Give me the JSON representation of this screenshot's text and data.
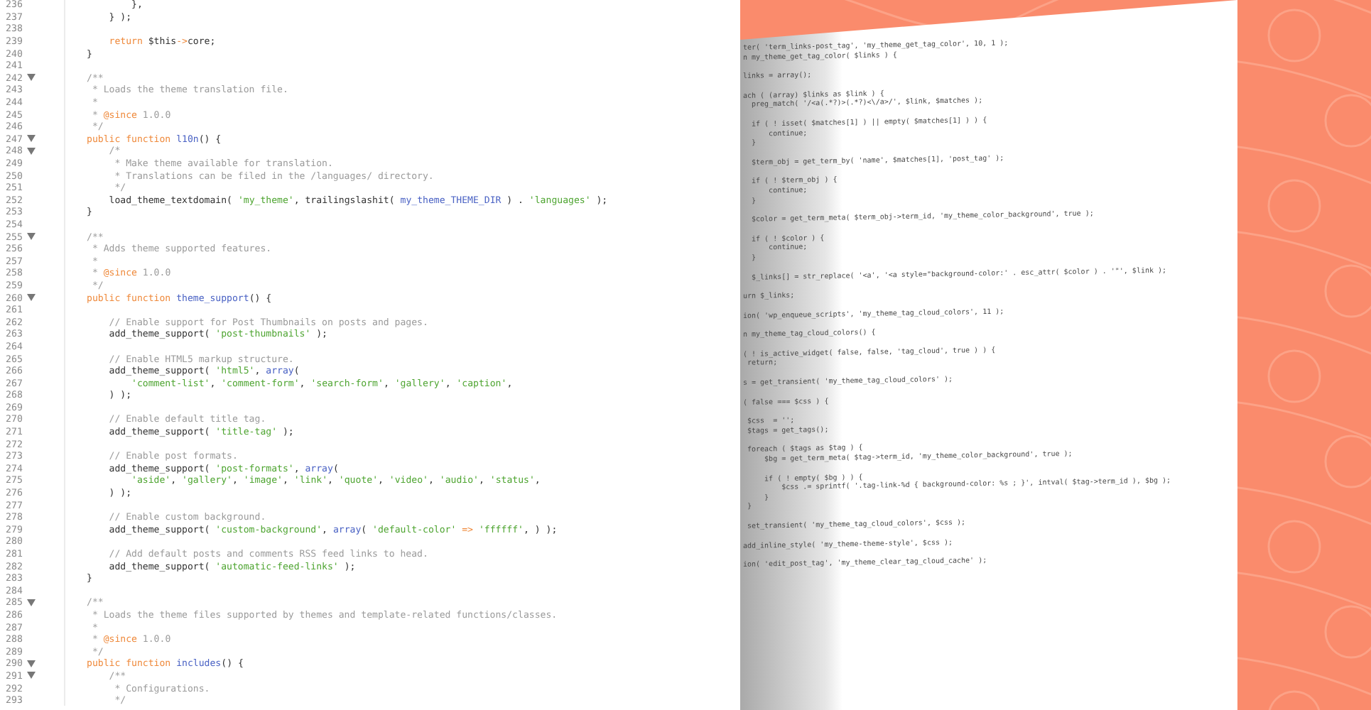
{
  "editor": {
    "lines": [
      {
        "number": "236",
        "fold": false,
        "tokens": [
          {
            "kind": "plain",
            "text": "        },"
          }
        ]
      },
      {
        "number": "237",
        "fold": false,
        "tokens": [
          {
            "kind": "plain",
            "text": "    } );"
          }
        ]
      },
      {
        "number": "238",
        "fold": false
      },
      {
        "number": "239",
        "fold": false,
        "tokens": [
          {
            "kind": "keyword",
            "text": "    return"
          },
          {
            "kind": "plain",
            "text": " $this"
          },
          {
            "kind": "keyword",
            "text": "->"
          },
          {
            "kind": "plain",
            "text": "core;"
          }
        ]
      },
      {
        "number": "240",
        "fold": false,
        "tokens": [
          {
            "kind": "plain",
            "text": "}"
          }
        ]
      },
      {
        "number": "241",
        "fold": false
      },
      {
        "number": "242",
        "fold": true,
        "tokens": [
          {
            "kind": "comment",
            "text": "/**"
          }
        ]
      },
      {
        "number": "243",
        "fold": false,
        "tokens": [
          {
            "kind": "comment",
            "text": " * Loads the theme translation file."
          }
        ]
      },
      {
        "number": "244",
        "fold": false,
        "tokens": [
          {
            "kind": "comment",
            "text": " *"
          }
        ]
      },
      {
        "number": "245",
        "fold": false,
        "tokens": [
          {
            "kind": "comment",
            "text": " * "
          },
          {
            "kind": "keyword",
            "text": "@since"
          },
          {
            "kind": "comment",
            "text": " 1.0.0"
          }
        ]
      },
      {
        "number": "246",
        "fold": false,
        "tokens": [
          {
            "kind": "comment",
            "text": " */"
          }
        ]
      },
      {
        "number": "247",
        "fold": true,
        "tokens": [
          {
            "kind": "keyword",
            "text": "public function "
          },
          {
            "kind": "function",
            "text": "l10n"
          },
          {
            "kind": "plain",
            "text": "() {"
          }
        ]
      },
      {
        "number": "248",
        "fold": true,
        "tokens": [
          {
            "kind": "comment",
            "text": "    /*"
          }
        ]
      },
      {
        "number": "249",
        "fold": false,
        "tokens": [
          {
            "kind": "comment",
            "text": "     * Make theme available for translation."
          }
        ]
      },
      {
        "number": "250",
        "fold": false,
        "tokens": [
          {
            "kind": "comment",
            "text": "     * Translations can be filed in the /languages/ directory."
          }
        ]
      },
      {
        "number": "251",
        "fold": false,
        "tokens": [
          {
            "kind": "comment",
            "text": "     */"
          }
        ]
      },
      {
        "number": "252",
        "fold": false,
        "tokens": [
          {
            "kind": "plain",
            "text": "    load_theme_textdomain( "
          },
          {
            "kind": "string",
            "text": "'my_theme'"
          },
          {
            "kind": "plain",
            "text": ", trailingslashit( "
          },
          {
            "kind": "function",
            "text": "my_theme_THEME_DIR"
          },
          {
            "kind": "plain",
            "text": " ) . "
          },
          {
            "kind": "string",
            "text": "'languages'"
          },
          {
            "kind": "plain",
            "text": " );"
          }
        ]
      },
      {
        "number": "253",
        "fold": false,
        "tokens": [
          {
            "kind": "plain",
            "text": "}"
          }
        ]
      },
      {
        "number": "254",
        "fold": false
      },
      {
        "number": "255",
        "fold": true,
        "tokens": [
          {
            "kind": "comment",
            "text": "/**"
          }
        ]
      },
      {
        "number": "256",
        "fold": false,
        "tokens": [
          {
            "kind": "comment",
            "text": " * Adds theme supported features."
          }
        ]
      },
      {
        "number": "257",
        "fold": false,
        "tokens": [
          {
            "kind": "comment",
            "text": " *"
          }
        ]
      },
      {
        "number": "258",
        "fold": false,
        "tokens": [
          {
            "kind": "comment",
            "text": " * "
          },
          {
            "kind": "keyword",
            "text": "@since"
          },
          {
            "kind": "comment",
            "text": " 1.0.0"
          }
        ]
      },
      {
        "number": "259",
        "fold": false,
        "tokens": [
          {
            "kind": "comment",
            "text": " */"
          }
        ]
      },
      {
        "number": "260",
        "fold": true,
        "tokens": [
          {
            "kind": "keyword",
            "text": "public function "
          },
          {
            "kind": "function",
            "text": "theme_support"
          },
          {
            "kind": "plain",
            "text": "() {"
          }
        ]
      },
      {
        "number": "261",
        "fold": false
      },
      {
        "number": "262",
        "fold": false,
        "tokens": [
          {
            "kind": "comment",
            "text": "    // Enable support for Post Thumbnails on posts and pages."
          }
        ]
      },
      {
        "number": "263",
        "fold": false,
        "tokens": [
          {
            "kind": "plain",
            "text": "    add_theme_support( "
          },
          {
            "kind": "string",
            "text": "'post-thumbnails'"
          },
          {
            "kind": "plain",
            "text": " );"
          }
        ]
      },
      {
        "number": "264",
        "fold": false
      },
      {
        "number": "265",
        "fold": false,
        "tokens": [
          {
            "kind": "comment",
            "text": "    // Enable HTML5 markup structure."
          }
        ]
      },
      {
        "number": "266",
        "fold": false,
        "tokens": [
          {
            "kind": "plain",
            "text": "    add_theme_support( "
          },
          {
            "kind": "string",
            "text": "'html5'"
          },
          {
            "kind": "plain",
            "text": ", "
          },
          {
            "kind": "function",
            "text": "array"
          },
          {
            "kind": "plain",
            "text": "("
          }
        ]
      },
      {
        "number": "267",
        "fold": false,
        "tokens": [
          {
            "kind": "string",
            "text": "        'comment-list'"
          },
          {
            "kind": "plain",
            "text": ", "
          },
          {
            "kind": "string",
            "text": "'comment-form'"
          },
          {
            "kind": "plain",
            "text": ", "
          },
          {
            "kind": "string",
            "text": "'search-form'"
          },
          {
            "kind": "plain",
            "text": ", "
          },
          {
            "kind": "string",
            "text": "'gallery'"
          },
          {
            "kind": "plain",
            "text": ", "
          },
          {
            "kind": "string",
            "text": "'caption'"
          },
          {
            "kind": "plain",
            "text": ","
          }
        ]
      },
      {
        "number": "268",
        "fold": false,
        "tokens": [
          {
            "kind": "plain",
            "text": "    ) );"
          }
        ]
      },
      {
        "number": "269",
        "fold": false
      },
      {
        "number": "270",
        "fold": false,
        "tokens": [
          {
            "kind": "comment",
            "text": "    // Enable default title tag."
          }
        ]
      },
      {
        "number": "271",
        "fold": false,
        "tokens": [
          {
            "kind": "plain",
            "text": "    add_theme_support( "
          },
          {
            "kind": "string",
            "text": "'title-tag'"
          },
          {
            "kind": "plain",
            "text": " );"
          }
        ]
      },
      {
        "number": "272",
        "fold": false
      },
      {
        "number": "273",
        "fold": false,
        "tokens": [
          {
            "kind": "comment",
            "text": "    // Enable post formats."
          }
        ]
      },
      {
        "number": "274",
        "fold": false,
        "tokens": [
          {
            "kind": "plain",
            "text": "    add_theme_support( "
          },
          {
            "kind": "string",
            "text": "'post-formats'"
          },
          {
            "kind": "plain",
            "text": ", "
          },
          {
            "kind": "function",
            "text": "array"
          },
          {
            "kind": "plain",
            "text": "("
          }
        ]
      },
      {
        "number": "275",
        "fold": false,
        "tokens": [
          {
            "kind": "string",
            "text": "        'aside'"
          },
          {
            "kind": "plain",
            "text": ", "
          },
          {
            "kind": "string",
            "text": "'gallery'"
          },
          {
            "kind": "plain",
            "text": ", "
          },
          {
            "kind": "string",
            "text": "'image'"
          },
          {
            "kind": "plain",
            "text": ", "
          },
          {
            "kind": "string",
            "text": "'link'"
          },
          {
            "kind": "plain",
            "text": ", "
          },
          {
            "kind": "string",
            "text": "'quote'"
          },
          {
            "kind": "plain",
            "text": ", "
          },
          {
            "kind": "string",
            "text": "'video'"
          },
          {
            "kind": "plain",
            "text": ", "
          },
          {
            "kind": "string",
            "text": "'audio'"
          },
          {
            "kind": "plain",
            "text": ", "
          },
          {
            "kind": "string",
            "text": "'status'"
          },
          {
            "kind": "plain",
            "text": ","
          }
        ]
      },
      {
        "number": "276",
        "fold": false,
        "tokens": [
          {
            "kind": "plain",
            "text": "    ) );"
          }
        ]
      },
      {
        "number": "277",
        "fold": false
      },
      {
        "number": "278",
        "fold": false,
        "tokens": [
          {
            "kind": "comment",
            "text": "    // Enable custom background."
          }
        ]
      },
      {
        "number": "279",
        "fold": false,
        "tokens": [
          {
            "kind": "plain",
            "text": "    add_theme_support( "
          },
          {
            "kind": "string",
            "text": "'custom-background'"
          },
          {
            "kind": "plain",
            "text": ", "
          },
          {
            "kind": "function",
            "text": "array"
          },
          {
            "kind": "plain",
            "text": "( "
          },
          {
            "kind": "string",
            "text": "'default-color'"
          },
          {
            "kind": "keyword",
            "text": " => "
          },
          {
            "kind": "string",
            "text": "'ffffff'"
          },
          {
            "kind": "plain",
            "text": ", ) );"
          }
        ]
      },
      {
        "number": "280",
        "fold": false
      },
      {
        "number": "281",
        "fold": false,
        "tokens": [
          {
            "kind": "comment",
            "text": "    // Add default posts and comments RSS feed links to head."
          }
        ]
      },
      {
        "number": "282",
        "fold": false,
        "tokens": [
          {
            "kind": "plain",
            "text": "    add_theme_support( "
          },
          {
            "kind": "string",
            "text": "'automatic-feed-links'"
          },
          {
            "kind": "plain",
            "text": " );"
          }
        ]
      },
      {
        "number": "283",
        "fold": false,
        "tokens": [
          {
            "kind": "plain",
            "text": "}"
          }
        ]
      },
      {
        "number": "284",
        "fold": false
      },
      {
        "number": "285",
        "fold": true,
        "tokens": [
          {
            "kind": "comment",
            "text": "/**"
          }
        ]
      },
      {
        "number": "286",
        "fold": false,
        "tokens": [
          {
            "kind": "comment",
            "text": " * Loads the theme files supported by themes and template-related functions/classes."
          }
        ]
      },
      {
        "number": "287",
        "fold": false,
        "tokens": [
          {
            "kind": "comment",
            "text": " *"
          }
        ]
      },
      {
        "number": "288",
        "fold": false,
        "tokens": [
          {
            "kind": "comment",
            "text": " * "
          },
          {
            "kind": "keyword",
            "text": "@since"
          },
          {
            "kind": "comment",
            "text": " 1.0.0"
          }
        ]
      },
      {
        "number": "289",
        "fold": false,
        "tokens": [
          {
            "kind": "comment",
            "text": " */"
          }
        ]
      },
      {
        "number": "290",
        "fold": true,
        "tokens": [
          {
            "kind": "keyword",
            "text": "public function "
          },
          {
            "kind": "function",
            "text": "includes"
          },
          {
            "kind": "plain",
            "text": "() {"
          }
        ]
      },
      {
        "number": "291",
        "fold": true,
        "tokens": [
          {
            "kind": "comment",
            "text": "    /**"
          }
        ]
      },
      {
        "number": "292",
        "fold": false,
        "tokens": [
          {
            "kind": "comment",
            "text": "     * Configurations."
          }
        ]
      },
      {
        "number": "293",
        "fold": false,
        "tokens": [
          {
            "kind": "comment",
            "text": "     */"
          }
        ]
      }
    ]
  },
  "code_sheet": {
    "blocks": [
      [
        "ter( 'term_links-post_tag', 'my_theme_get_tag_color', 10, 1 );",
        "n my_theme_get_tag_color( $links ) {"
      ],
      [
        "links = array();"
      ],
      [
        "ach ( (array) $links as $link ) {",
        "  preg_match( '/<a(.*?)>(.*?)<\\/a>/', $link, $matches );"
      ],
      [
        "  if ( ! isset( $matches[1] ) || empty( $matches[1] ) ) {",
        "      continue;",
        "  }"
      ],
      [
        "  $term_obj = get_term_by( 'name', $matches[1], 'post_tag' );"
      ],
      [
        "  if ( ! $term_obj ) {",
        "      continue;",
        "  }"
      ],
      [
        "  $color = get_term_meta( $term_obj->term_id, 'my_theme_color_background', true );"
      ],
      [
        "  if ( ! $color ) {",
        "      continue;",
        "  }"
      ],
      [
        "  $_links[] = str_replace( '<a', '<a style=\"background-color:' . esc_attr( $color ) . '\"', $link );"
      ],
      [
        "urn $_links;"
      ],
      [
        "ion( 'wp_enqueue_scripts', 'my_theme_tag_cloud_colors', 11 );"
      ],
      [
        "n my_theme_tag_cloud_colors() {"
      ],
      [
        "( ! is_active_widget( false, false, 'tag_cloud', true ) ) {",
        " return;"
      ],
      [
        "s = get_transient( 'my_theme_tag_cloud_colors' );"
      ],
      [
        "( false === $css ) {"
      ],
      [
        " $css  = '';",
        " $tags = get_tags();"
      ],
      [
        " foreach ( $tags as $tag ) {",
        "     $bg = get_term_meta( $tag->term_id, 'my_theme_color_background', true );"
      ],
      [
        "     if ( ! empty( $bg ) ) {",
        "         $css .= sprintf( '.tag-link-%d { background-color: %s ; }', intval( $tag->term_id ), $bg );",
        "     }",
        " }"
      ],
      [
        " set_transient( 'my_theme_tag_cloud_colors', $css );"
      ],
      [
        "add_inline_style( 'my_theme-theme-style', $css );"
      ],
      [
        "ion( 'edit_post_tag', 'my_theme_clear_tag_cloud_cache' );"
      ]
    ]
  }
}
